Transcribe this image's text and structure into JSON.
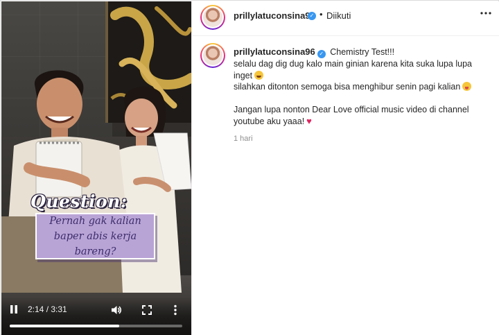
{
  "video": {
    "overlay_title": "Question:",
    "overlay_text": "Pernah gak kalian baper abis kerja bareng?",
    "time_display": "2:14 / 3:31",
    "progress": 0.635
  },
  "post": {
    "username": "prillylatuconsina96",
    "follow_status": "Diikuti",
    "caption": {
      "line1": "Chemistry Test!!!",
      "line2": "selalu dag dig dug kalo main ginian karena kita suka lupa lupa inget",
      "line3": "silahkan ditonton semoga bisa menghibur senin pagi kalian",
      "line4": "Jangan lupa nonton Dear Love official music video di channel youtube aku yaaa!"
    },
    "timestamp": "1 hari"
  },
  "icons": {
    "verified": "verified-badge-icon",
    "more_horizontal": "more-horizontal-icon",
    "play_pause": "pause-icon",
    "volume": "volume-icon",
    "fullscreen": "fullscreen-icon",
    "more_vertical": "more-vertical-icon"
  },
  "colors": {
    "accent_verified": "#3897f0",
    "overlay_box": "#b9a4d6",
    "heart": "#e0245e"
  }
}
